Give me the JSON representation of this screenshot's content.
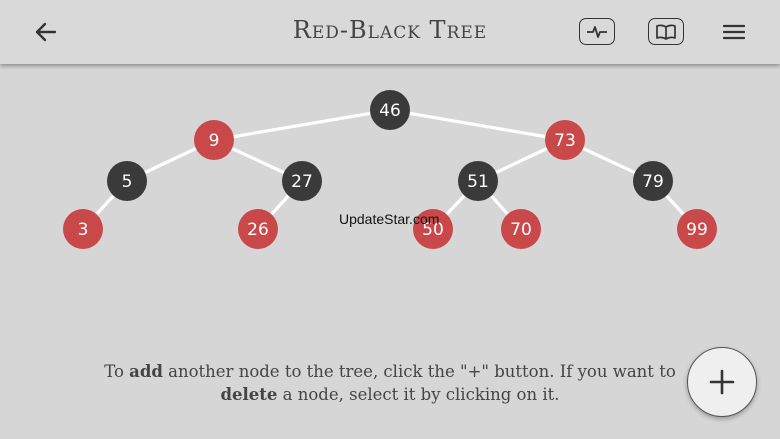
{
  "header": {
    "title": "Red-Black Tree",
    "back_icon": "arrow-left-icon",
    "stats_icon": "pulse-icon",
    "book_icon": "book-icon",
    "menu_icon": "hamburger-menu-icon"
  },
  "colors": {
    "red_node": "#c9484a",
    "black_node": "#3a3a3a",
    "edge": "#ffffff",
    "background": "#d6d6d6"
  },
  "tree": {
    "nodes": [
      {
        "key": "46",
        "color": "black"
      },
      {
        "key": "9",
        "color": "red"
      },
      {
        "key": "73",
        "color": "red"
      },
      {
        "key": "5",
        "color": "black"
      },
      {
        "key": "27",
        "color": "black"
      },
      {
        "key": "51",
        "color": "black"
      },
      {
        "key": "79",
        "color": "black"
      },
      {
        "key": "3",
        "color": "red"
      },
      {
        "key": "26",
        "color": "red"
      },
      {
        "key": "50",
        "color": "red"
      },
      {
        "key": "70",
        "color": "red"
      },
      {
        "key": "99",
        "color": "red"
      }
    ],
    "edges": [
      [
        "46",
        "9"
      ],
      [
        "46",
        "73"
      ],
      [
        "9",
        "5"
      ],
      [
        "9",
        "27"
      ],
      [
        "73",
        "51"
      ],
      [
        "73",
        "79"
      ],
      [
        "5",
        "3"
      ],
      [
        "27",
        "26"
      ],
      [
        "51",
        "50"
      ],
      [
        "51",
        "70"
      ],
      [
        "79",
        "99"
      ]
    ]
  },
  "watermark": "UpdateStar.com",
  "instructions": {
    "part1": "To ",
    "add_word": "add",
    "part2": " another node to the tree, click the \"+\" button. If you want to",
    "delete_word": "delete",
    "part3": " a node, select it by clicking on it."
  },
  "fab": {
    "icon": "plus-icon"
  }
}
